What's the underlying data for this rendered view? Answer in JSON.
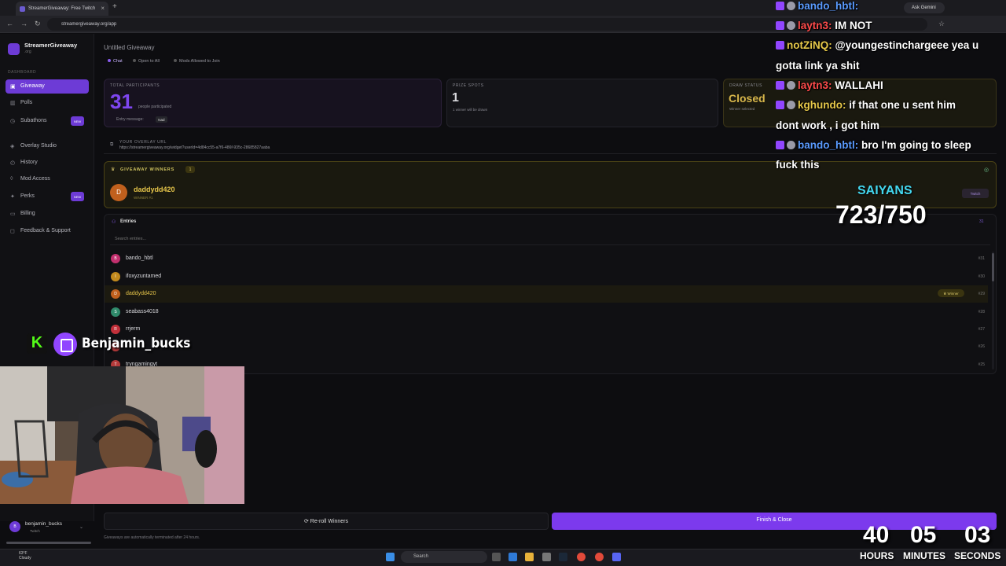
{
  "browser": {
    "tab_title": "StreamerGiveaway: Free Twitch",
    "url": "streamergiveaway.org/app",
    "gemini_label": "Ask Gemini"
  },
  "brand": {
    "name": "StreamerGiveaway",
    "sub": ".org"
  },
  "sidebar": {
    "section": "DASHBOARD",
    "items": [
      {
        "label": "Giveaway",
        "icon": "gift-icon"
      },
      {
        "label": "Polls",
        "icon": "poll-icon"
      },
      {
        "label": "Subathons",
        "icon": "clock-icon",
        "badge": "NEW"
      },
      {
        "label": "Overlay Studio",
        "icon": "layers-icon"
      },
      {
        "label": "History",
        "icon": "history-icon"
      },
      {
        "label": "Mod Access",
        "icon": "shield-icon"
      },
      {
        "label": "Perks",
        "icon": "star-icon",
        "badge": "NEW"
      },
      {
        "label": "Billing",
        "icon": "card-icon"
      },
      {
        "label": "Feedback & Support",
        "icon": "chat-icon"
      }
    ],
    "user": {
      "name": "benjamin_bucks",
      "platform": "Twitch",
      "initial": "B"
    }
  },
  "header": {
    "title": "Untitled Giveaway",
    "filters": [
      "Chat",
      "Open to All",
      "Mods Allowed to Join"
    ]
  },
  "stats": {
    "participants_label": "TOTAL PARTICIPANTS",
    "participants_value": "31",
    "participants_caption": "people participated",
    "entry_message_label": "Entry message:",
    "entry_message_value": "!sad",
    "prize_label": "PRIZE SPOTS",
    "prize_value": "1",
    "prize_caption": "1 winner will be drawn",
    "draw_label": "DRAW STATUS",
    "draw_value": "Closed",
    "draw_caption": "Winner selected"
  },
  "overlay": {
    "label": "YOUR OVERLAY URL",
    "url": "https://streamergiveaway.org/widget?userId=4d84cc55-a7f6-486f-935c-28685827aaba"
  },
  "winners": {
    "title": "GIVEAWAY WINNERS",
    "count": "1",
    "winner_name": "daddydd420",
    "winner_sub": "WINNER #1",
    "winner_initial": "D",
    "platform": "Twitch"
  },
  "entries": {
    "title": "Entries",
    "count": "31",
    "search_placeholder": "Search entries...",
    "rows": [
      {
        "name": "bando_hbtl",
        "num": "#31",
        "initial": "B",
        "color": "#c2306e"
      },
      {
        "name": "ifoxyzuntamed",
        "num": "#30",
        "initial": "I",
        "color": "#c28a1d"
      },
      {
        "name": "daddydd420",
        "num": "#29",
        "initial": "D",
        "color": "#c0601d",
        "winner": "Winner"
      },
      {
        "name": "seabass4018",
        "num": "#28",
        "initial": "S",
        "color": "#2f8a6a"
      },
      {
        "name": "rrjerm",
        "num": "#27",
        "initial": "R",
        "color": "#c2303a"
      },
      {
        "name": "",
        "num": "#26",
        "initial": "",
        "color": "#b33a3a"
      },
      {
        "name": "tryngamingyt",
        "num": "#25",
        "initial": "T",
        "color": "#b33a3a"
      }
    ]
  },
  "actions": {
    "reroll": "Re-roll Winners",
    "finish": "Finish & Close",
    "note": "Giveaways are automatically terminated after 24 hours."
  },
  "taskbar": {
    "search": "Search",
    "weather_temp": "63°F",
    "weather_desc": "Cloudy"
  },
  "stream": {
    "chat": [
      {
        "user": "bando_hbtl:",
        "msg": "",
        "ucolor": "u1"
      },
      {
        "user": "laytn3:",
        "msg": "IM NOT",
        "ucolor": "u2"
      },
      {
        "user": "notZiNQ:",
        "msg": "@youngestinchargeee yea u",
        "ucolor": "u3",
        "plain": true
      },
      {
        "user": "",
        "msg": "gotta link ya shit",
        "plain": true,
        "cont": true
      },
      {
        "user": "laytn3:",
        "msg": "WALLAHI",
        "ucolor": "u2"
      },
      {
        "user": "kghundo:",
        "msg": "if that one u sent him",
        "ucolor": "u3"
      },
      {
        "user": "",
        "msg": "dont work , i got him",
        "cont": true
      },
      {
        "user": "bando_hbtl:",
        "msg": "bro I'm going to sleep",
        "ucolor": "u1"
      },
      {
        "user": "",
        "msg": "fuck this",
        "cont": true
      }
    ],
    "goal_label": "SAIYANS",
    "goal_value": "723/750",
    "streamer": "Benjamin_bucks",
    "timer": [
      {
        "value": "40",
        "label": "HOURS"
      },
      {
        "value": "05",
        "label": "MINUTES"
      },
      {
        "value": "03",
        "label": "SECONDS"
      }
    ]
  }
}
